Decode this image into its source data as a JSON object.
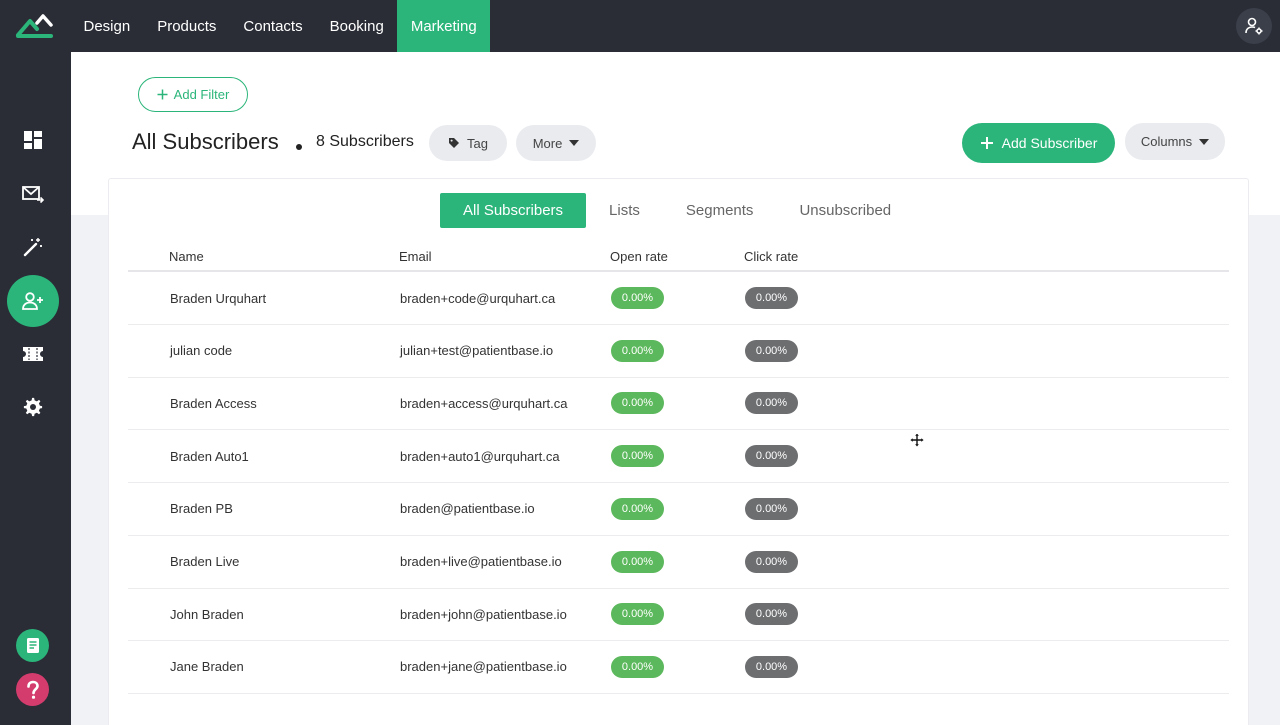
{
  "nav": {
    "items": [
      {
        "label": "Design"
      },
      {
        "label": "Products"
      },
      {
        "label": "Contacts"
      },
      {
        "label": "Booking"
      },
      {
        "label": "Marketing"
      }
    ],
    "active": "Marketing"
  },
  "sidebar": {
    "items": [
      "dashboard-icon",
      "mail-forward-icon",
      "magic-wand-icon",
      "add-user-icon",
      "ticket-icon",
      "gear-icon"
    ],
    "bottom": [
      "notes-icon",
      "help-icon"
    ]
  },
  "toolbar": {
    "add_filter": "Add Filter",
    "title": "All Subscribers",
    "count": "8 Subscribers",
    "tag": "Tag",
    "more": "More",
    "add_subscriber": "Add Subscriber",
    "columns": "Columns"
  },
  "tabs": [
    "All Subscribers",
    "Lists",
    "Segments",
    "Unsubscribed"
  ],
  "table": {
    "headers": [
      "Name",
      "Email",
      "Open rate",
      "Click rate"
    ],
    "rows": [
      {
        "name": "Braden Urquhart",
        "email": "braden+code@urquhart.ca",
        "open": "0.00%",
        "click": "0.00%"
      },
      {
        "name": "julian code",
        "email": "julian+test@patientbase.io",
        "open": "0.00%",
        "click": "0.00%"
      },
      {
        "name": "Braden Access",
        "email": "braden+access@urquhart.ca",
        "open": "0.00%",
        "click": "0.00%"
      },
      {
        "name": "Braden Auto1",
        "email": "braden+auto1@urquhart.ca",
        "open": "0.00%",
        "click": "0.00%"
      },
      {
        "name": "Braden PB",
        "email": "braden@patientbase.io",
        "open": "0.00%",
        "click": "0.00%"
      },
      {
        "name": "Braden Live",
        "email": "braden+live@patientbase.io",
        "open": "0.00%",
        "click": "0.00%"
      },
      {
        "name": "John Braden",
        "email": "braden+john@patientbase.io",
        "open": "0.00%",
        "click": "0.00%"
      },
      {
        "name": "Jane Braden",
        "email": "braden+jane@patientbase.io",
        "open": "0.00%",
        "click": "0.00%"
      }
    ]
  },
  "colors": {
    "accent": "#2bb57a",
    "nav_bg": "#2a2d36",
    "open_badge": "#5cb85c",
    "click_badge": "#6d6e70",
    "help": "#d43c6e"
  }
}
